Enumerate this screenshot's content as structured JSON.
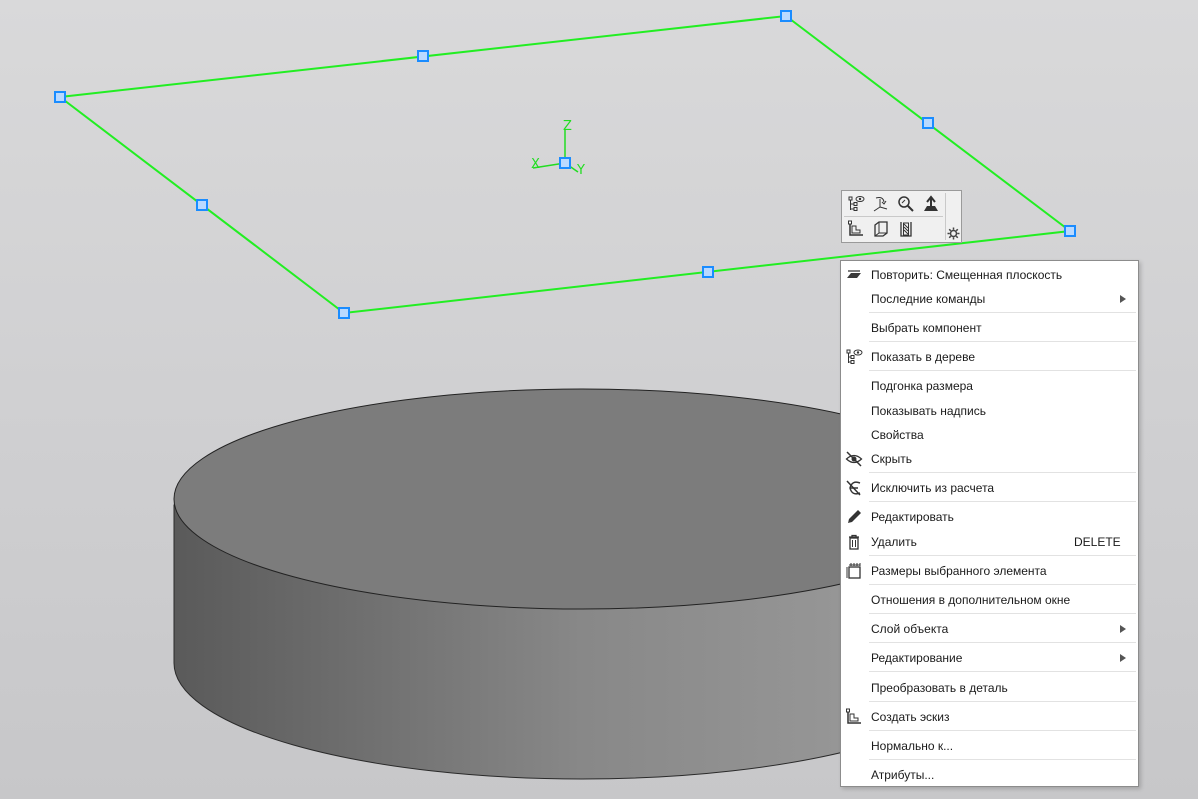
{
  "scene": {
    "plane_color": "#22ee22",
    "handle_color": "#1a8cff",
    "cylinder_top_color": "#7c7c7c",
    "cylinder_side_dark": "#5c5c5c",
    "cylinder_side_light": "#9b9b9b",
    "axes": {
      "z": "Z",
      "x": "X",
      "y": "Y"
    }
  },
  "mini_toolbar": {
    "buttons": [
      "show-in-tree-icon",
      "sketch-normal-icon",
      "zoom-to-icon",
      "export-icon",
      "create-sketch-icon",
      "section-view-icon",
      "hatch-view-icon",
      "settings-gear-icon"
    ]
  },
  "context_menu": {
    "items": [
      {
        "label": "Повторить: Смещенная плоскость",
        "icon": "offset-plane-icon"
      },
      {
        "label": "Последние команды",
        "submenu": true
      },
      {
        "label": "Выбрать компонент"
      },
      {
        "label": "Показать в дереве",
        "icon": "tree-eye-icon"
      },
      {
        "label": "Подгонка размера"
      },
      {
        "label": "Показывать надпись"
      },
      {
        "label": "Свойства"
      },
      {
        "label": "Скрыть",
        "icon": "eye-hide-icon"
      },
      {
        "label": "Исключить из расчета",
        "icon": "exclude-icon"
      },
      {
        "label": "Редактировать",
        "icon": "pencil-icon"
      },
      {
        "label": "Удалить",
        "shortcut": "DELETE",
        "icon": "trash-icon"
      },
      {
        "label": "Размеры выбранного элемента",
        "icon": "dimensions-icon"
      },
      {
        "label": "Отношения в дополнительном окне"
      },
      {
        "label": "Слой объекта",
        "submenu": true
      },
      {
        "label": "Редактирование",
        "submenu": true
      },
      {
        "label": "Преобразовать в деталь"
      },
      {
        "label": "Создать эскиз",
        "icon": "create-sketch-icon"
      },
      {
        "label": "Нормально к..."
      },
      {
        "label": "Атрибуты..."
      }
    ]
  }
}
